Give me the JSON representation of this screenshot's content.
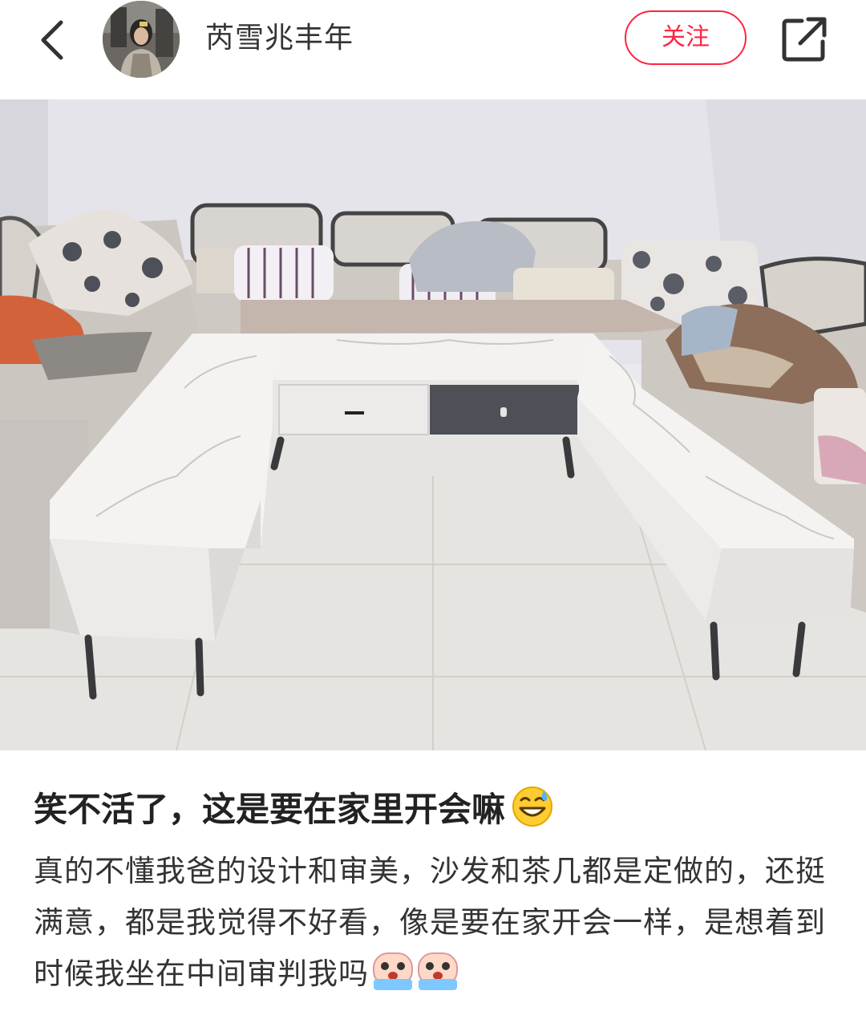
{
  "header": {
    "author_name": "芮雪兆丰年",
    "follow_label": "关注"
  },
  "post": {
    "title": "笑不活了，这是要在家里开会嘛",
    "body": "真的不懂我爸的设计和审美，沙发和茶几都是定做的，还挺满意，都是我觉得不好看，像是要在家开会一样，是想着到时候我坐在中间审判我吗"
  },
  "icons": {
    "back": "chevron-left-icon",
    "share": "share-icon",
    "title_emoji": "sweat-smile-emoji-icon",
    "body_emoji": "crying-face-emoji-icon"
  },
  "colors": {
    "accent": "#ff2442",
    "text": "#333333"
  }
}
